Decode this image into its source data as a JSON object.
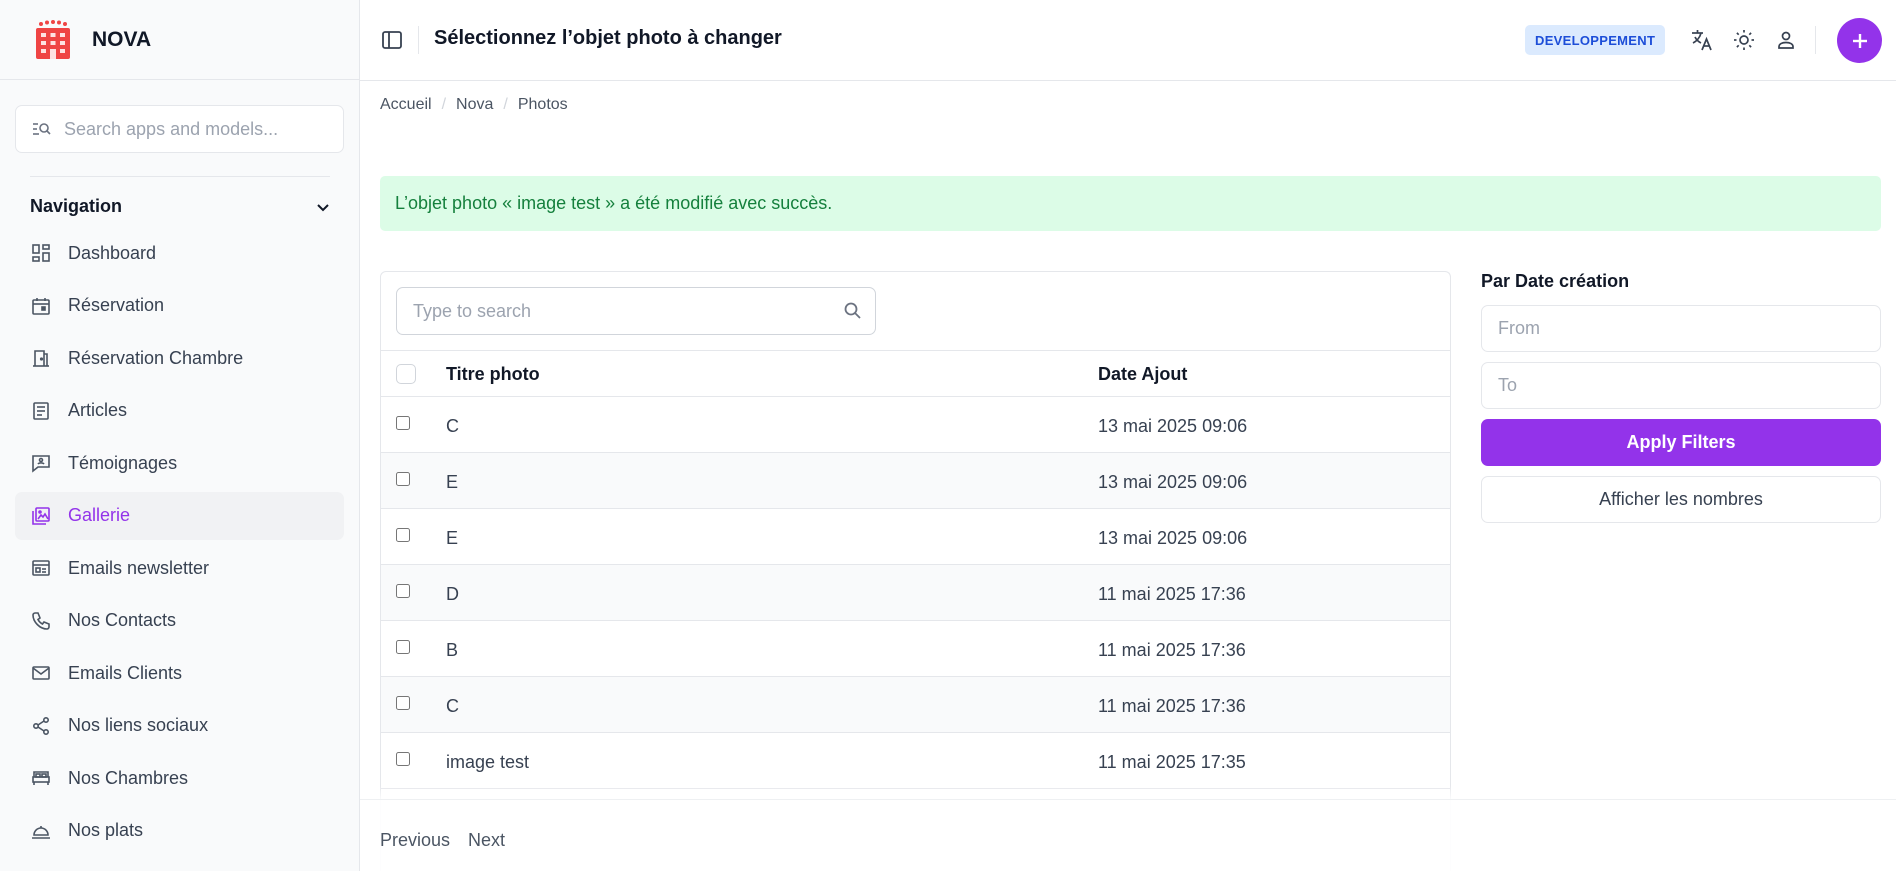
{
  "brand": {
    "name": "NOVA"
  },
  "sidebar": {
    "search_placeholder": "Search apps and models...",
    "nav_title": "Navigation",
    "items": [
      {
        "label": "Dashboard",
        "icon": "dashboard-icon"
      },
      {
        "label": "Réservation",
        "icon": "calendar-icon"
      },
      {
        "label": "Réservation Chambre",
        "icon": "door-icon"
      },
      {
        "label": "Articles",
        "icon": "article-icon"
      },
      {
        "label": "Témoignages",
        "icon": "chat-icon"
      },
      {
        "label": "Gallerie",
        "icon": "gallery-icon",
        "active": true
      },
      {
        "label": "Emails newsletter",
        "icon": "newsletter-icon"
      },
      {
        "label": "Nos Contacts",
        "icon": "phone-icon"
      },
      {
        "label": "Emails Clients",
        "icon": "mail-icon"
      },
      {
        "label": "Nos liens sociaux",
        "icon": "share-icon"
      },
      {
        "label": "Nos Chambres",
        "icon": "bed-icon"
      },
      {
        "label": "Nos plats",
        "icon": "dish-icon"
      }
    ]
  },
  "header": {
    "title": "Sélectionnez l’objet photo à changer",
    "env_badge": "DEVELOPPEMENT"
  },
  "breadcrumb": [
    "Accueil",
    "Nova",
    "Photos"
  ],
  "message": "L’objet photo « image test » a été modifié avec succès.",
  "table": {
    "search_placeholder": "Type to search",
    "columns": [
      "Titre photo",
      "Date Ajout"
    ],
    "rows": [
      {
        "title": "C",
        "date": "13 mai 2025 09:06"
      },
      {
        "title": "E",
        "date": "13 mai 2025 09:06"
      },
      {
        "title": "E",
        "date": "13 mai 2025 09:06"
      },
      {
        "title": "D",
        "date": "11 mai 2025 17:36"
      },
      {
        "title": "B",
        "date": "11 mai 2025 17:36"
      },
      {
        "title": "C",
        "date": "11 mai 2025 17:36"
      },
      {
        "title": "image test",
        "date": "11 mai 2025 17:35"
      }
    ]
  },
  "filters": {
    "title": "Par Date création",
    "from_placeholder": "From",
    "to_placeholder": "To",
    "apply_label": "Apply Filters",
    "count_label": "Afficher les nombres"
  },
  "pagination": {
    "previous": "Previous",
    "next": "Next"
  },
  "colors": {
    "accent": "#9333ea",
    "success_bg": "#dcfce7",
    "success_text": "#15803d",
    "badge_bg": "#dbeafe",
    "badge_text": "#1d4ed8"
  }
}
